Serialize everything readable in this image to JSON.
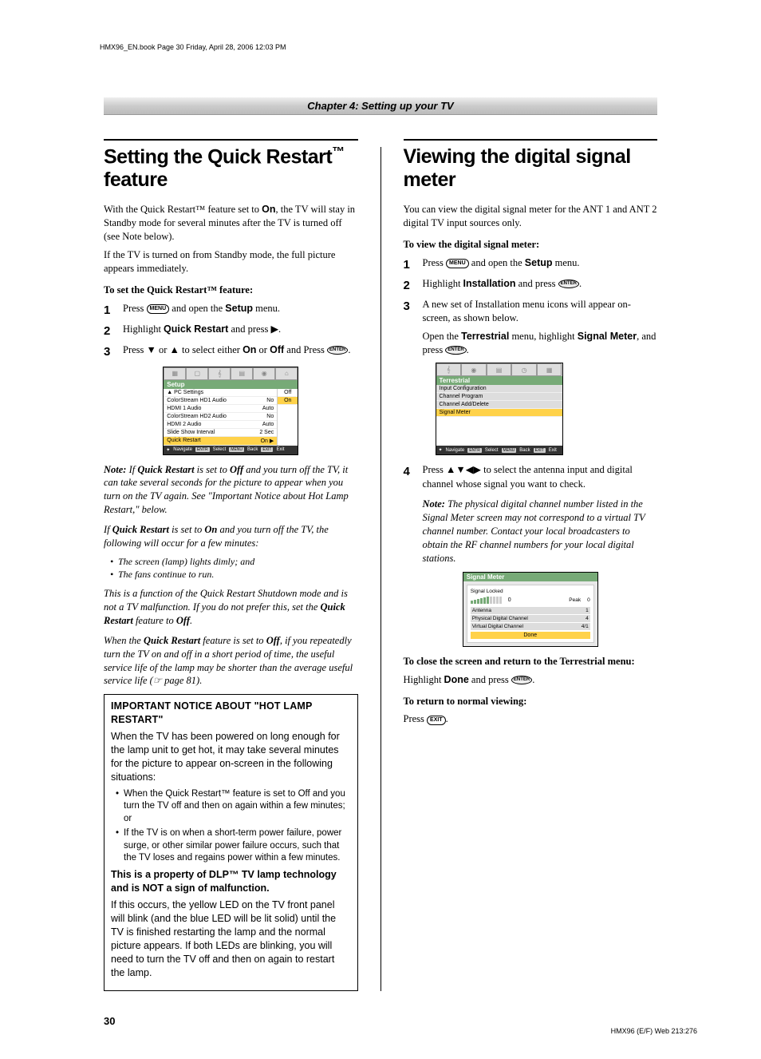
{
  "header": "HMX96_EN.book  Page 30  Friday, April 28, 2006  12:03 PM",
  "chapter": "Chapter 4: Setting up your TV",
  "left": {
    "h1_a": "Setting the Quick Restart",
    "h1_tm": "™",
    "h1_b": " feature",
    "intro1a": "With the Quick Restart™ feature set to ",
    "intro1b": "On",
    "intro1c": ", the TV will stay in Standby mode for several minutes after the TV is turned off (see Note below).",
    "intro2": "If the TV is turned on from Standby mode, the full picture appears immediately.",
    "sub1": "To set the Quick Restart™ feature:",
    "s1a": "Press ",
    "menu_btn": "MENU",
    "s1b": " and open the ",
    "s1_setup": "Setup",
    "s1c": " menu.",
    "s2a": "Highlight ",
    "s2_qr": "Quick Restart",
    "s2b": " and press ▶.",
    "s3a": "Press ▼ or ▲ to select either ",
    "s3_on": "On",
    "s3b": " or ",
    "s3_off": "Off",
    "s3c": " and Press ",
    "enter_btn": "ENTER",
    "s3d": ".",
    "osd": {
      "title": "Setup",
      "rows": [
        {
          "l": "▲ PC Settings",
          "r": ""
        },
        {
          "l": "ColorStream HD1 Audio",
          "r": "No"
        },
        {
          "l": "HDMI 1 Audio",
          "r": "Auto"
        },
        {
          "l": "ColorStream HD2 Audio",
          "r": "No"
        },
        {
          "l": "HDMI 2 Audio",
          "r": "Auto"
        },
        {
          "l": "Slide Show Interval",
          "r": "2 Sec"
        },
        {
          "l": "Quick Restart",
          "r": "On ▶"
        }
      ],
      "opts": [
        "Off",
        "On"
      ],
      "foot": {
        "nav": "Navigate",
        "sel": "Select",
        "back": "Back",
        "exit": "Exit"
      }
    },
    "note1a": "If ",
    "note1b": "Quick Restart",
    "note1c": " is set to ",
    "note1d": "Off",
    "note1e": " and you turn off the TV, it can take several seconds for the picture to appear when you turn on the TV again. See \"Important Notice about Hot Lamp Restart,\" below.",
    "note2a": "If ",
    "note2b": "Quick Restart",
    "note2c": " is set to ",
    "note2d": "On",
    "note2e": " and you turn off the TV, the following will occur for a few minutes:",
    "bul1": "The screen (lamp) lights dimly; and",
    "bul2": "The fans continue to run.",
    "note3a": "This is a function of the Quick Restart Shutdown mode and is not a TV malfunction. If you do not prefer this, set the ",
    "note3b": "Quick Restart",
    "note3c": " feature to ",
    "note3d": "Off",
    "note3e": ".",
    "note4a": "When the ",
    "note4b": "Quick Restart",
    "note4c": " feature is set to ",
    "note4d": "Off",
    "note4e": ", if you repeatedly turn the TV on and off in a short period of time, the useful service life of the lamp may be shorter than the average useful service life (☞ page 81).",
    "notice": {
      "title": "IMPORTANT NOTICE ABOUT \"HOT LAMP RESTART\"",
      "p1": "When the TV has been powered on long enough for the lamp unit to get hot, it may take several minutes for the picture to appear on-screen in the following situations:",
      "li1": "When the Quick Restart™ feature is set to Off and you turn the TV off and then on again within a few minutes; or",
      "li2": "If the TV is on when a short-term power failure, power surge, or other similar power failure occurs, such that the TV loses and regains power within a few minutes.",
      "p2": "This is a property of DLP™ TV lamp technology and is NOT a sign of malfunction.",
      "p3": "If this occurs, the yellow LED on the TV front panel will blink (and the blue LED will be lit solid) until the TV is finished restarting the lamp and the normal picture appears. If both LEDs are blinking, you will need to turn the TV off and then on again to restart the lamp."
    }
  },
  "right": {
    "h1": "Viewing the digital signal meter",
    "intro": "You can view the digital signal meter for the ANT 1 and ANT 2 digital TV input sources only.",
    "sub1": "To view the digital signal meter:",
    "s1a": "Press ",
    "s1b": " and open the ",
    "s1_setup": "Setup",
    "s1c": " menu.",
    "s2a": "Highlight ",
    "s2_inst": "Installation",
    "s2b": " and press ",
    "s2c": ".",
    "s3a": "A new set of Installation menu icons will appear on-screen, as shown below.",
    "s3b1": "Open the ",
    "s3_terr": "Terrestrial",
    "s3b2": " menu, highlight ",
    "s3_sm": "Signal Meter",
    "s3b3": ", and press ",
    "s3b4": ".",
    "osd2": {
      "title": "Terrestrial",
      "rows": [
        "Input Configuration",
        "Channel Program",
        "Channel Add/Delete",
        "Signal Meter"
      ],
      "foot": {
        "nav": "Navigate",
        "sel": "Select",
        "back": "Back",
        "exit": "Exit"
      }
    },
    "s4a": "Press ▲▼◀▶ to select the antenna input and digital channel whose signal you want to check.",
    "note1": "The physical digital channel number listed in the Signal Meter screen may not correspond to a virtual TV channel number. Contact your local broadcasters to obtain the RF channel numbers for your local digital stations.",
    "osd3": {
      "title": "Signal Meter",
      "locked": "Signal Locked",
      "val": "0",
      "peak_l": "Peak",
      "peak_v": "0",
      "rows": [
        {
          "l": "Antenna",
          "r": "1"
        },
        {
          "l": "Physical Digital Channel",
          "r": "4"
        },
        {
          "l": "Virtual Digital Channel",
          "r": "4/1"
        }
      ],
      "done": "Done"
    },
    "sub2": "To close the screen and return to the Terrestrial menu:",
    "close_a": "Highlight ",
    "close_b": "Done",
    "close_c": " and press ",
    "close_d": ".",
    "sub3": "To return to normal viewing:",
    "ret_a": "Press ",
    "exit_btn": "EXIT",
    "ret_b": "."
  },
  "page_num": "30",
  "footer": "HMX96 (E/F) Web 213:276"
}
